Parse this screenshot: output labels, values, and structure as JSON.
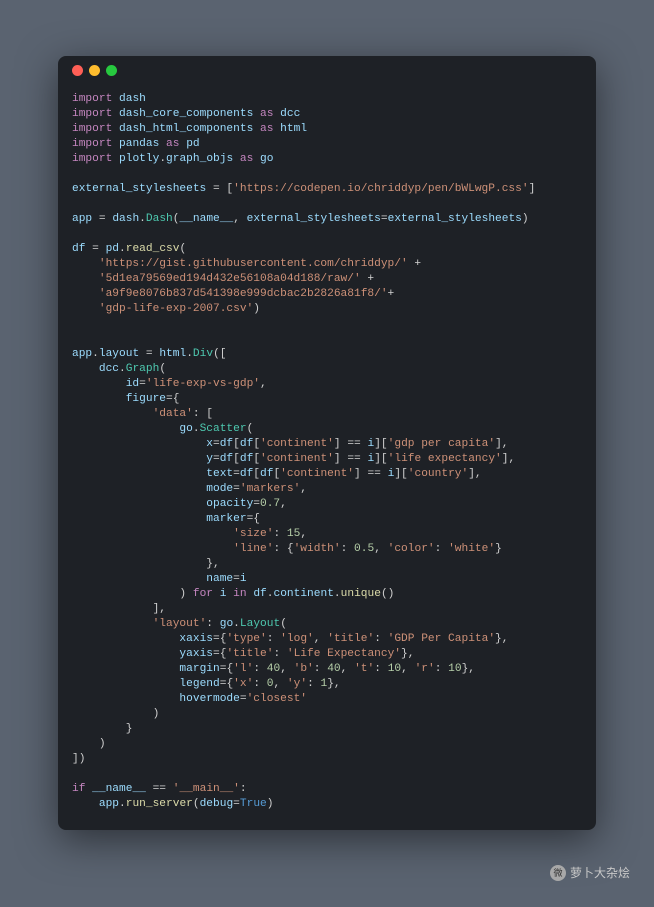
{
  "window": {
    "dots": {
      "red": "#ff5f56",
      "yellow": "#ffbd2e",
      "green": "#27c93f"
    },
    "bg": "#1e2126"
  },
  "code": {
    "l01_import": "import",
    "l01_mod": "dash",
    "l02_import": "import",
    "l02_mod": "dash_core_components",
    "l02_as": "as",
    "l02_alias": "dcc",
    "l03_import": "import",
    "l03_mod": "dash_html_components",
    "l03_as": "as",
    "l03_alias": "html",
    "l04_import": "import",
    "l04_mod": "pandas",
    "l04_as": "as",
    "l04_alias": "pd",
    "l05_import": "import",
    "l05_mod_a": "plotly",
    "l05_mod_b": "graph_objs",
    "l05_as": "as",
    "l05_alias": "go",
    "l07_var": "external_stylesheets",
    "l07_str": "'https://codepen.io/chriddyp/pen/bWLwgP.css'",
    "l09_app": "app",
    "l09_dash": "dash",
    "l09_Dash": "Dash",
    "l09_name": "__name__",
    "l09_ext": "external_stylesheets",
    "l09_ext2": "external_stylesheets",
    "l11_df": "df",
    "l11_pd": "pd",
    "l11_read": "read_csv",
    "l12_str": "'https://gist.githubusercontent.com/chriddyp/'",
    "l13_str": "'5d1ea79569ed194d432e56108a04d188/raw/'",
    "l14_str": "'a9f9e8076b837d541398e999dcbac2b2826a81f8/'",
    "l15_str": "'gdp-life-exp-2007.csv'",
    "l18_app": "app",
    "l18_layout": "layout",
    "l18_html": "html",
    "l18_Div": "Div",
    "l19_dcc": "dcc",
    "l19_Graph": "Graph",
    "l20_id": "id",
    "l20_str": "'life-exp-vs-gdp'",
    "l21_figure": "figure",
    "l22_data": "'data'",
    "l23_go": "go",
    "l23_Scatter": "Scatter",
    "l24_x": "x",
    "l24_df": "df",
    "l24_df2": "df",
    "l24_cont": "'continent'",
    "l24_i": "i",
    "l24_gdp": "'gdp per capita'",
    "l25_y": "y",
    "l25_df": "df",
    "l25_df2": "df",
    "l25_cont": "'continent'",
    "l25_i": "i",
    "l25_life": "'life expectancy'",
    "l26_text": "text",
    "l26_df": "df",
    "l26_df2": "df",
    "l26_cont": "'continent'",
    "l26_i": "i",
    "l26_country": "'country'",
    "l27_mode": "mode",
    "l27_str": "'markers'",
    "l28_opacity": "opacity",
    "l28_val": "0.7",
    "l29_marker": "marker",
    "l30_size": "'size'",
    "l30_val": "15",
    "l31_line": "'line'",
    "l31_width": "'width'",
    "l31_wval": "0.5",
    "l31_color": "'color'",
    "l31_cval": "'white'",
    "l33_name": "name",
    "l33_i": "i",
    "l34_for": "for",
    "l34_i": "i",
    "l34_in": "in",
    "l34_df": "df",
    "l34_cont": "continent",
    "l34_unique": "unique",
    "l36_layout": "'layout'",
    "l36_go": "go",
    "l36_Layout": "Layout",
    "l37_xaxis": "xaxis",
    "l37_type": "'type'",
    "l37_log": "'log'",
    "l37_title": "'title'",
    "l37_gdp": "'GDP Per Capita'",
    "l38_yaxis": "yaxis",
    "l38_title": "'title'",
    "l38_life": "'Life Expectancy'",
    "l39_margin": "margin",
    "l39_l": "'l'",
    "l39_lv": "40",
    "l39_b": "'b'",
    "l39_bv": "40",
    "l39_t": "'t'",
    "l39_tv": "10",
    "l39_r": "'r'",
    "l39_rv": "10",
    "l40_legend": "legend",
    "l40_x": "'x'",
    "l40_xv": "0",
    "l40_y": "'y'",
    "l40_yv": "1",
    "l41_hover": "hovermode",
    "l41_closest": "'closest'",
    "l47_if": "if",
    "l47_name": "__name__",
    "l47_main": "'__main__'",
    "l48_app": "app",
    "l48_run": "run_server",
    "l48_debug": "debug",
    "l48_true": "True"
  },
  "watermark": {
    "label": "萝卜大杂烩",
    "icon": "微"
  }
}
